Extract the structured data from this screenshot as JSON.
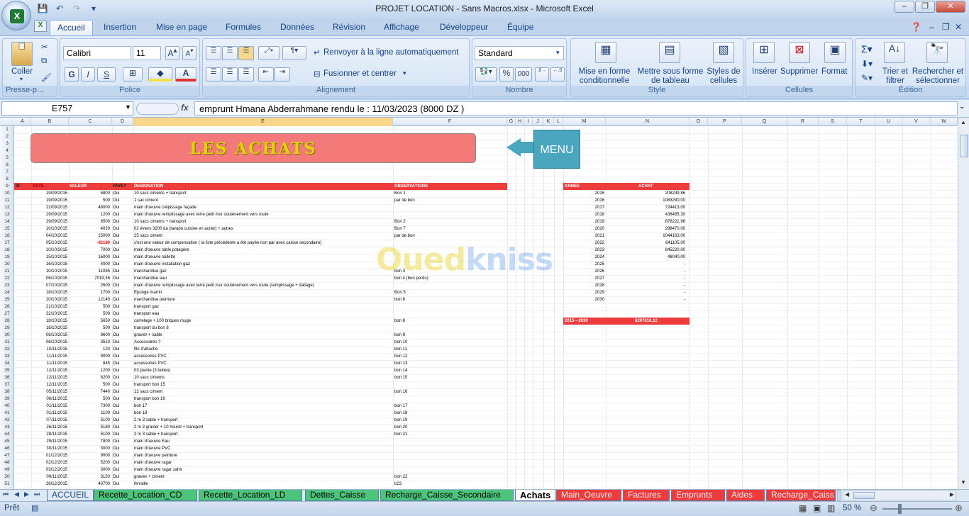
{
  "window": {
    "title": "PROJET LOCATION - Sans Macros.xlsx - Microsoft Excel"
  },
  "tabs": [
    "Accueil",
    "Insertion",
    "Mise en page",
    "Formules",
    "Données",
    "Révision",
    "Affichage",
    "Développeur",
    "Équipe"
  ],
  "ribbon": {
    "clipboard": {
      "paste": "Coller",
      "label": "Presse-p..."
    },
    "font": {
      "name": "Calibri",
      "size": "11",
      "label": "Police",
      "bold": "G",
      "italic": "I",
      "underline": "S"
    },
    "alignment": {
      "wrap": "Renvoyer à la ligne automatiquement",
      "merge": "Fusionner et centrer",
      "label": "Alignement"
    },
    "number": {
      "format": "Standard",
      "label": "Nombre",
      "percent": "%",
      "thousands": "000"
    },
    "style": {
      "cond": "Mise en forme conditionnelle",
      "table": "Mettre sous forme de tableau",
      "cell": "Styles de cellules",
      "label": "Style"
    },
    "cells": {
      "insert": "Insérer",
      "delete": "Supprimer",
      "format": "Format",
      "label": "Cellules"
    },
    "editing": {
      "sort": "Trier et filtrer",
      "find": "Rechercher et sélectionner",
      "label": "Édition"
    }
  },
  "formula_bar": {
    "name_box": "E757",
    "fx": "fx",
    "value": "emprunt Hmana Abderrahmane rendu le : 11/03/2023 (8000 DZ )"
  },
  "columns": [
    "A",
    "B",
    "C",
    "D",
    "E",
    "F",
    "G",
    "H",
    "I",
    "J",
    "K",
    "L",
    "M",
    "N",
    "O",
    "P",
    "Q",
    "R",
    "S",
    "T",
    "U",
    "V",
    "W"
  ],
  "banner": "LES ACHATS",
  "menu_button": "MENU",
  "headers": {
    "id": "ID",
    "date": "DATE",
    "valeur": "VALEUR",
    "paye": "PAYE?",
    "designation": "DESIGNATION",
    "observations": "OBSERVATIONS",
    "annee": "ANNEE",
    "achat": "ACHAT"
  },
  "rows": [
    [
      "19/09/2015",
      "5800",
      "Oui",
      "10 sacs ciments + transport",
      "Bon 1"
    ],
    [
      "19/09/2015",
      "500",
      "Oui",
      "1 sac ciment",
      "par de bon"
    ],
    [
      "22/09/2015",
      "48000",
      "Oui",
      "main d'oeuvre crépissage façade",
      ""
    ],
    [
      "29/09/2015",
      "1200",
      "Oui",
      "main d'oeuvre remplissage avec terre petit mur soutènement vers route",
      ""
    ],
    [
      "29/09/2015",
      "6500",
      "Oui",
      "10 sacs ciments + transport",
      "Bon 2"
    ],
    [
      "10/10/2015",
      "4020",
      "Oui",
      "02 éviers 3200 da (lavabo cuisine en acrier) + autres",
      "Bon 7"
    ],
    [
      "04/10/2015",
      "15000",
      "Oui",
      "25 sacs ciment",
      "par de bon"
    ],
    [
      "05/10/2015",
      "-81180",
      "Oui",
      "c'est une valeur de compensation ( la liste précédente a été payée non par avec caisse secondaire)",
      ""
    ],
    [
      "10/10/2015",
      "7000",
      "Oui",
      "main d'oeuvre table potagère",
      ""
    ],
    [
      "15/10/2015",
      "16000",
      "Oui",
      "main d'oeuvre taillette",
      ""
    ],
    [
      "16/10/2015",
      "4000",
      "Oui",
      "main d'oeuvre installation gaz",
      ""
    ],
    [
      "10/10/2015",
      "11085",
      "Oui",
      "marchandise gaz",
      "bon 3"
    ],
    [
      "06/10/2015",
      "7019,36",
      "Oui",
      "marchandise eau",
      "bon 4 (bon perdu)"
    ],
    [
      "07/10/2015",
      "2600",
      "Oui",
      "main d'oeuvre remplissage avec terre petit mur soutènement vers route (remplissage + dallage)",
      ""
    ],
    [
      "18/10/2015",
      "1700",
      "Oui",
      "Eponge marrin",
      "Bon 5"
    ],
    [
      "20/10/2015",
      "12140",
      "Oui",
      "marchandise peinture",
      "bon 6"
    ],
    [
      "21/10/2015",
      "500",
      "Oui",
      "transport gaz",
      ""
    ],
    [
      "22/10/2015",
      "500",
      "Oui",
      "transport eau",
      ""
    ],
    [
      "18/10/2015",
      "5650",
      "Oui",
      "carrelage + 100 briques rouge",
      "bon 8"
    ],
    [
      "18/10/2015",
      "500",
      "Oui",
      "transport du bon 8",
      ""
    ],
    [
      "08/10/2015",
      "9600",
      "Oui",
      "gravier + sable",
      "bon 9"
    ],
    [
      "06/10/2015",
      "3510",
      "Oui",
      "Accessoires ?",
      "bon 10"
    ],
    [
      "10/11/2015",
      "120",
      "Oui",
      "file d'attache",
      "bon 11"
    ],
    [
      "11/11/2015",
      "9000",
      "Oui",
      "accessoires PVC",
      "bon 12"
    ],
    [
      "11/11/2015",
      "845",
      "Oui",
      "accessoires PVC",
      "bon 13"
    ],
    [
      "12/11/2015",
      "1200",
      "Oui",
      "03 plante (3 boites)",
      "bon 14"
    ],
    [
      "12/11/2015",
      "6200",
      "Oui",
      "10 sacs ciments",
      "bon 15"
    ],
    [
      "12/11/2015",
      "500",
      "Oui",
      "transport bon 15",
      ""
    ],
    [
      "05/11/2015",
      "7440",
      "Oui",
      "12 sacs ciment",
      "bon 16"
    ],
    [
      "06/11/2015",
      "500",
      "Oui",
      "transport bon 16",
      ""
    ],
    [
      "01/11/2015",
      "7300",
      "Oui",
      "bon 17",
      "bon 17"
    ],
    [
      "01/11/2015",
      "1100",
      "Oui",
      "bon 18",
      "bon 18"
    ],
    [
      "07/11/2015",
      "5100",
      "Oui",
      "2 m 3 sable + transport",
      "bon 19"
    ],
    [
      "26/11/2015",
      "5180",
      "Oui",
      "2 m 3 gravier + 10 hourdi + transport",
      "bon 20"
    ],
    [
      "28/11/2015",
      "5100",
      "Oui",
      "2 m 3 sable + transport",
      "bon 21"
    ],
    [
      "29/11/2015",
      "7800",
      "Oui",
      "main d'oeuvre Eau",
      ""
    ],
    [
      "30/11/2015",
      "3000",
      "Oui",
      "main d'oeuvre PVC",
      ""
    ],
    [
      "01/12/2015",
      "9000",
      "Oui",
      "main d'oeuvre peinture",
      ""
    ],
    [
      "02/12/2015",
      "5200",
      "Oui",
      "main d'oeuvre ragar",
      ""
    ],
    [
      "03/12/2015",
      "3000",
      "Oui",
      "main d'oeuvre ragar zahir",
      ""
    ],
    [
      "09/11/2015",
      "3150",
      "Oui",
      "gravier + ciment",
      "bon 22"
    ],
    [
      "28/12/2015",
      "40700",
      "Oui",
      "ferraille",
      "b23"
    ]
  ],
  "summary": [
    [
      "2015",
      "208239,86"
    ],
    [
      "2016",
      "1083290,00"
    ],
    [
      "2017",
      "724413,00"
    ],
    [
      "2018",
      "438455,30"
    ],
    [
      "2019",
      "876221,96"
    ],
    [
      "2020",
      "298470,00"
    ],
    [
      "2021",
      "1044163,00"
    ],
    [
      "2022",
      "641105,00"
    ],
    [
      "2023",
      "845220,00"
    ],
    [
      "2024",
      "48040,00"
    ],
    [
      "2025",
      "-"
    ],
    [
      "2026",
      "-"
    ],
    [
      "2027",
      "-"
    ],
    [
      "2028",
      "-"
    ],
    [
      "2029",
      "-"
    ],
    [
      "2030",
      "-"
    ]
  ],
  "total": {
    "label": "2015---2030",
    "value": "6207618,12"
  },
  "watermark": {
    "a": "Oued",
    "b": "kniss",
    ".com": ""
  },
  "sheet_tabs": [
    "ACCUEIL",
    "Recette_Location_CD",
    "Recette_Location_LD",
    "Dettes_Caisse",
    "Recharge_Caisse_Secondaire",
    "Achats",
    "Main_Oeuvre",
    "Factures",
    "Emprunts",
    "Aides",
    "Recharge_Caiss"
  ],
  "status": {
    "ready": "Prêt",
    "zoom": "50 %"
  }
}
